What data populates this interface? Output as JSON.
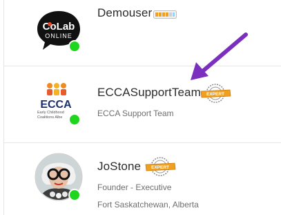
{
  "members": [
    {
      "name": "Demouser",
      "avatar_text_top": "CoLab",
      "avatar_text_bottom": "ONLINE",
      "badge": "level-bar-icon",
      "online": true
    },
    {
      "name": "ECCASupportTeam",
      "subtitle": "ECCA Support Team",
      "avatar_logo": "ECCA",
      "avatar_logo_sub1": "Early Childhood",
      "avatar_logo_sub2": "Coalitions Albe",
      "badge": "expert-stamp-icon",
      "badge_text": "EXPERT",
      "online": true
    },
    {
      "name": "JoStone",
      "role": "Founder - Executive",
      "location": "Fort Saskatchewan, Alberta",
      "badge": "expert-stamp-icon",
      "badge_text": "EXPERT",
      "online": true
    }
  ],
  "colors": {
    "presence": "#1fd61f",
    "arrow": "#7b2fbf",
    "badge_orange": "#f0a020"
  }
}
